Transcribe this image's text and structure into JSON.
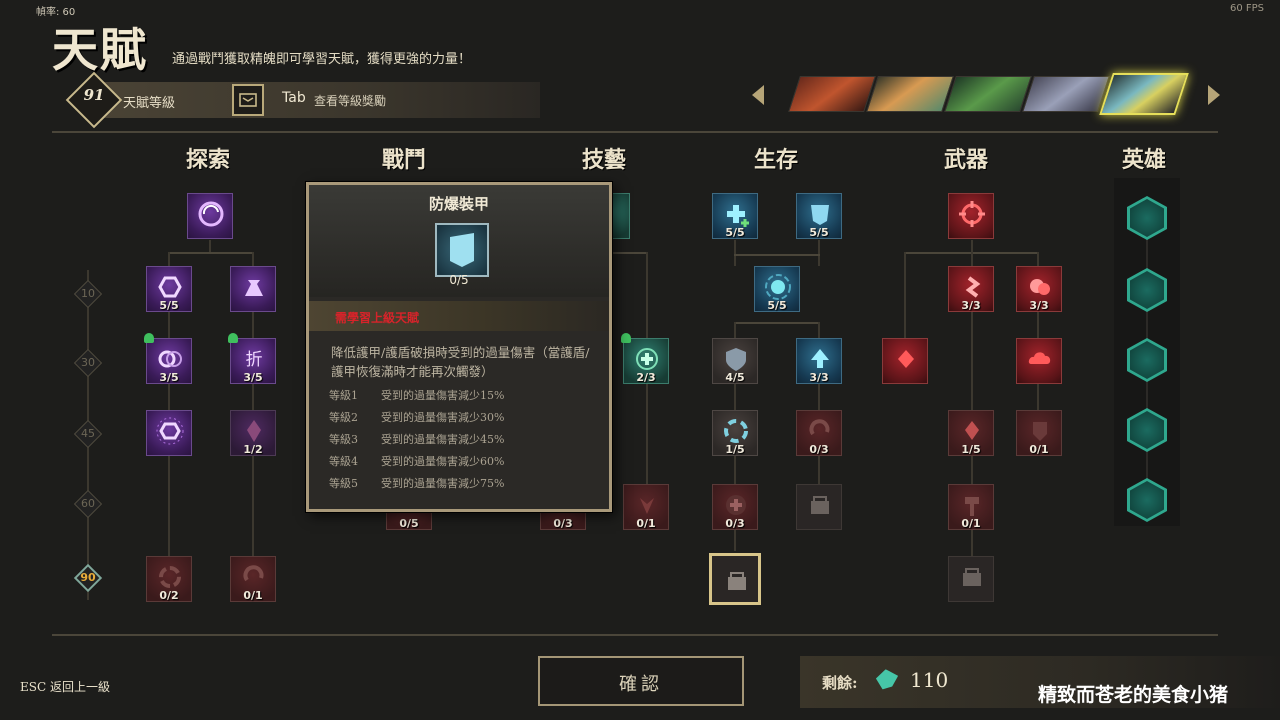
{
  "top": {
    "fps_left": "幀率: 60",
    "fps_right": "60 FPS"
  },
  "header": {
    "title": "天賦",
    "subtitle": "通過戰鬥獲取精魄即可學習天賦，獲得更強的力量！",
    "talent_level": "91",
    "talent_level_label": "天賦等級",
    "tab_key": "Tab",
    "tab_desc": "查看等級獎勵"
  },
  "categories": [
    "探索",
    "戰鬥",
    "技藝",
    "生存",
    "武器",
    "英雄"
  ],
  "level_markers": [
    "10",
    "30",
    "45",
    "60",
    "90"
  ],
  "tiles": {
    "explore": [
      "5/5",
      "3/5",
      "3/5",
      "1/2",
      "0/2",
      "0/1"
    ],
    "combat": [
      "0/5"
    ],
    "craft": [
      "2/3",
      "0/3",
      "0/1"
    ],
    "survival": [
      "5/5",
      "5/5",
      "5/5",
      "4/5",
      "3/3",
      "1/5",
      "0/3",
      "0/3"
    ],
    "weapon": [
      "3/3",
      "3/3",
      "1/5",
      "0/1",
      "0/1"
    ]
  },
  "tooltip": {
    "name": "防爆裝甲",
    "count": "0/5",
    "requirement": "需學習上級天賦",
    "description": "降低護甲/護盾破損時受到的過量傷害（當護盾/護甲恢復滿時才能再次觸發）",
    "levels": [
      {
        "label": "等級1",
        "text": "受到的過量傷害減少15%"
      },
      {
        "label": "等級2",
        "text": "受到的過量傷害減少30%"
      },
      {
        "label": "等級3",
        "text": "受到的過量傷害減少45%"
      },
      {
        "label": "等級4",
        "text": "受到的過量傷害減少60%"
      },
      {
        "label": "等級5",
        "text": "受到的過量傷害減少75%"
      }
    ]
  },
  "footer": {
    "esc": "ESC 返回上一級",
    "confirm": "確認",
    "remain_label": "剩餘:",
    "remain_value": "110",
    "watermark": "精致而苍老的美食小猪"
  },
  "colors": {
    "accent": "#d8c58a",
    "hero_hex": "#2fa88e",
    "req_red": "#d8232a",
    "selected_portrait": "#e6df5a"
  }
}
